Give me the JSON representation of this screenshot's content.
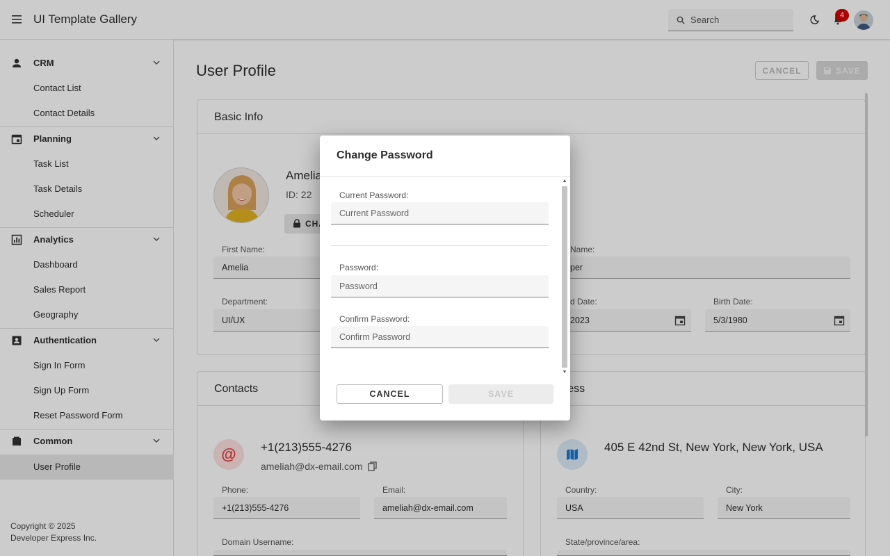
{
  "header": {
    "app_title": "UI Template Gallery",
    "search_placeholder": "Search",
    "notification_count": "4"
  },
  "sidebar": {
    "groups": [
      {
        "label": "CRM",
        "icon": "person-icon",
        "items": [
          "Contact List",
          "Contact Details"
        ]
      },
      {
        "label": "Planning",
        "icon": "calendar-icon",
        "items": [
          "Task List",
          "Task Details",
          "Scheduler"
        ]
      },
      {
        "label": "Analytics",
        "icon": "chart-icon",
        "items": [
          "Dashboard",
          "Sales Report",
          "Geography"
        ]
      },
      {
        "label": "Authentication",
        "icon": "id-card-icon",
        "items": [
          "Sign In Form",
          "Sign Up Form",
          "Reset Password Form"
        ]
      },
      {
        "label": "Common",
        "icon": "folder-icon",
        "items": [
          "User Profile"
        ]
      }
    ],
    "selected_item": "User Profile",
    "copyright_line1": "Copyright © 2025",
    "copyright_line2": "Developer Express Inc."
  },
  "page": {
    "title": "User Profile",
    "cancel_label": "CANCEL",
    "save_label": "SAVE"
  },
  "basic_info": {
    "title": "Basic Info",
    "name": "Amelia",
    "id_text": "ID: 22",
    "change_btn": "CHA",
    "first_name_label": "First Name:",
    "first_name": "Amelia",
    "last_name_label": "Name:",
    "last_name": "per",
    "department_label": "Department:",
    "department": "UI/UX",
    "hired_label": "d Date:",
    "hired": "2023",
    "birth_label": "Birth Date:",
    "birth": "5/3/1980"
  },
  "contacts": {
    "title": "Contacts",
    "phone_big": "+1(213)555-4276",
    "email_big": "ameliah@dx-email.com",
    "phone_label": "Phone:",
    "phone": "+1(213)555-4276",
    "email_label": "Email:",
    "email": "ameliah@dx-email.com",
    "domain_label": "Domain Username:"
  },
  "address": {
    "title": "dress",
    "full": "405 E 42nd St, New York, New York, USA",
    "country_label": "Country:",
    "country": "USA",
    "city_label": "City:",
    "city": "New York",
    "state_label": "State/province/area:"
  },
  "dialog": {
    "title": "Change Password",
    "current_label": "Current Password:",
    "current_placeholder": "Current Password",
    "password_label": "Password:",
    "password_placeholder": "Password",
    "confirm_label": "Confirm Password:",
    "confirm_placeholder": "Confirm Password",
    "cancel_label": "CANCEL",
    "save_label": "SAVE"
  }
}
